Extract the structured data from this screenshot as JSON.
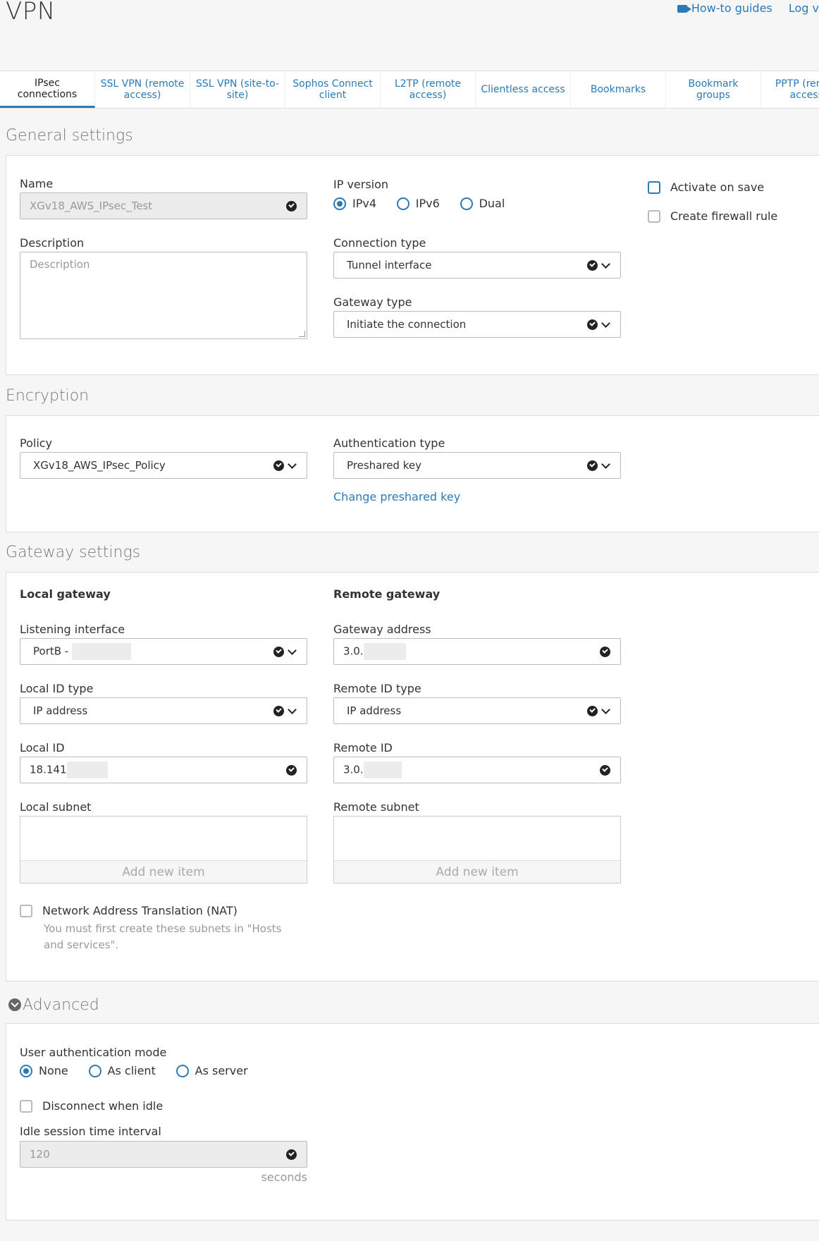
{
  "header": {
    "title": "VPN",
    "howto": "How-to guides",
    "log": "Log v"
  },
  "tabs": [
    "IPsec connections",
    "SSL VPN (remote access)",
    "SSL VPN (site-to-site)",
    "Sophos Connect client",
    "L2TP (remote access)",
    "Clientless access",
    "Bookmarks",
    "Bookmark groups",
    "PPTP (remote access)"
  ],
  "general": {
    "title": "General settings",
    "name_label": "Name",
    "name_value": "XGv18_AWS_IPsec_Test",
    "description_label": "Description",
    "description_placeholder": "Description",
    "ip_version_label": "IP version",
    "ip_options": [
      "IPv4",
      "IPv6",
      "Dual"
    ],
    "ip_selected": "IPv4",
    "connection_type_label": "Connection type",
    "connection_type_value": "Tunnel interface",
    "gateway_type_label": "Gateway type",
    "gateway_type_value": "Initiate the connection",
    "activate_label": "Activate on save",
    "firewall_label": "Create firewall rule"
  },
  "encryption": {
    "title": "Encryption",
    "policy_label": "Policy",
    "policy_value": "XGv18_AWS_IPsec_Policy",
    "auth_type_label": "Authentication type",
    "auth_type_value": "Preshared key",
    "change_key_link": "Change preshared key"
  },
  "gateway": {
    "title": "Gateway settings",
    "local_heading": "Local gateway",
    "remote_heading": "Remote gateway",
    "listening_label": "Listening interface",
    "listening_value": "PortB -",
    "gateway_address_label": "Gateway address",
    "gateway_address_value": "3.0.",
    "local_id_type_label": "Local ID type",
    "local_id_type_value": "IP address",
    "remote_id_type_label": "Remote ID type",
    "remote_id_type_value": "IP address",
    "local_id_label": "Local ID",
    "local_id_value": "18.141",
    "remote_id_label": "Remote ID",
    "remote_id_value": "3.0.",
    "local_subnet_label": "Local subnet",
    "remote_subnet_label": "Remote subnet",
    "add_item": "Add new item",
    "nat_label": "Network Address Translation (NAT)",
    "nat_hint_1": "You must first create these subnets in \"Hosts",
    "nat_hint_2": "and services\"."
  },
  "advanced": {
    "title": "Advanced",
    "user_auth_label": "User authentication mode",
    "auth_options": [
      "None",
      "As client",
      "As server"
    ],
    "auth_selected": "None",
    "disconnect_label": "Disconnect when idle",
    "idle_label": "Idle session time interval",
    "idle_value": "120",
    "seconds": "seconds"
  },
  "colors": {
    "accent": "#2a7ab8",
    "background": "#f6f6f6"
  }
}
